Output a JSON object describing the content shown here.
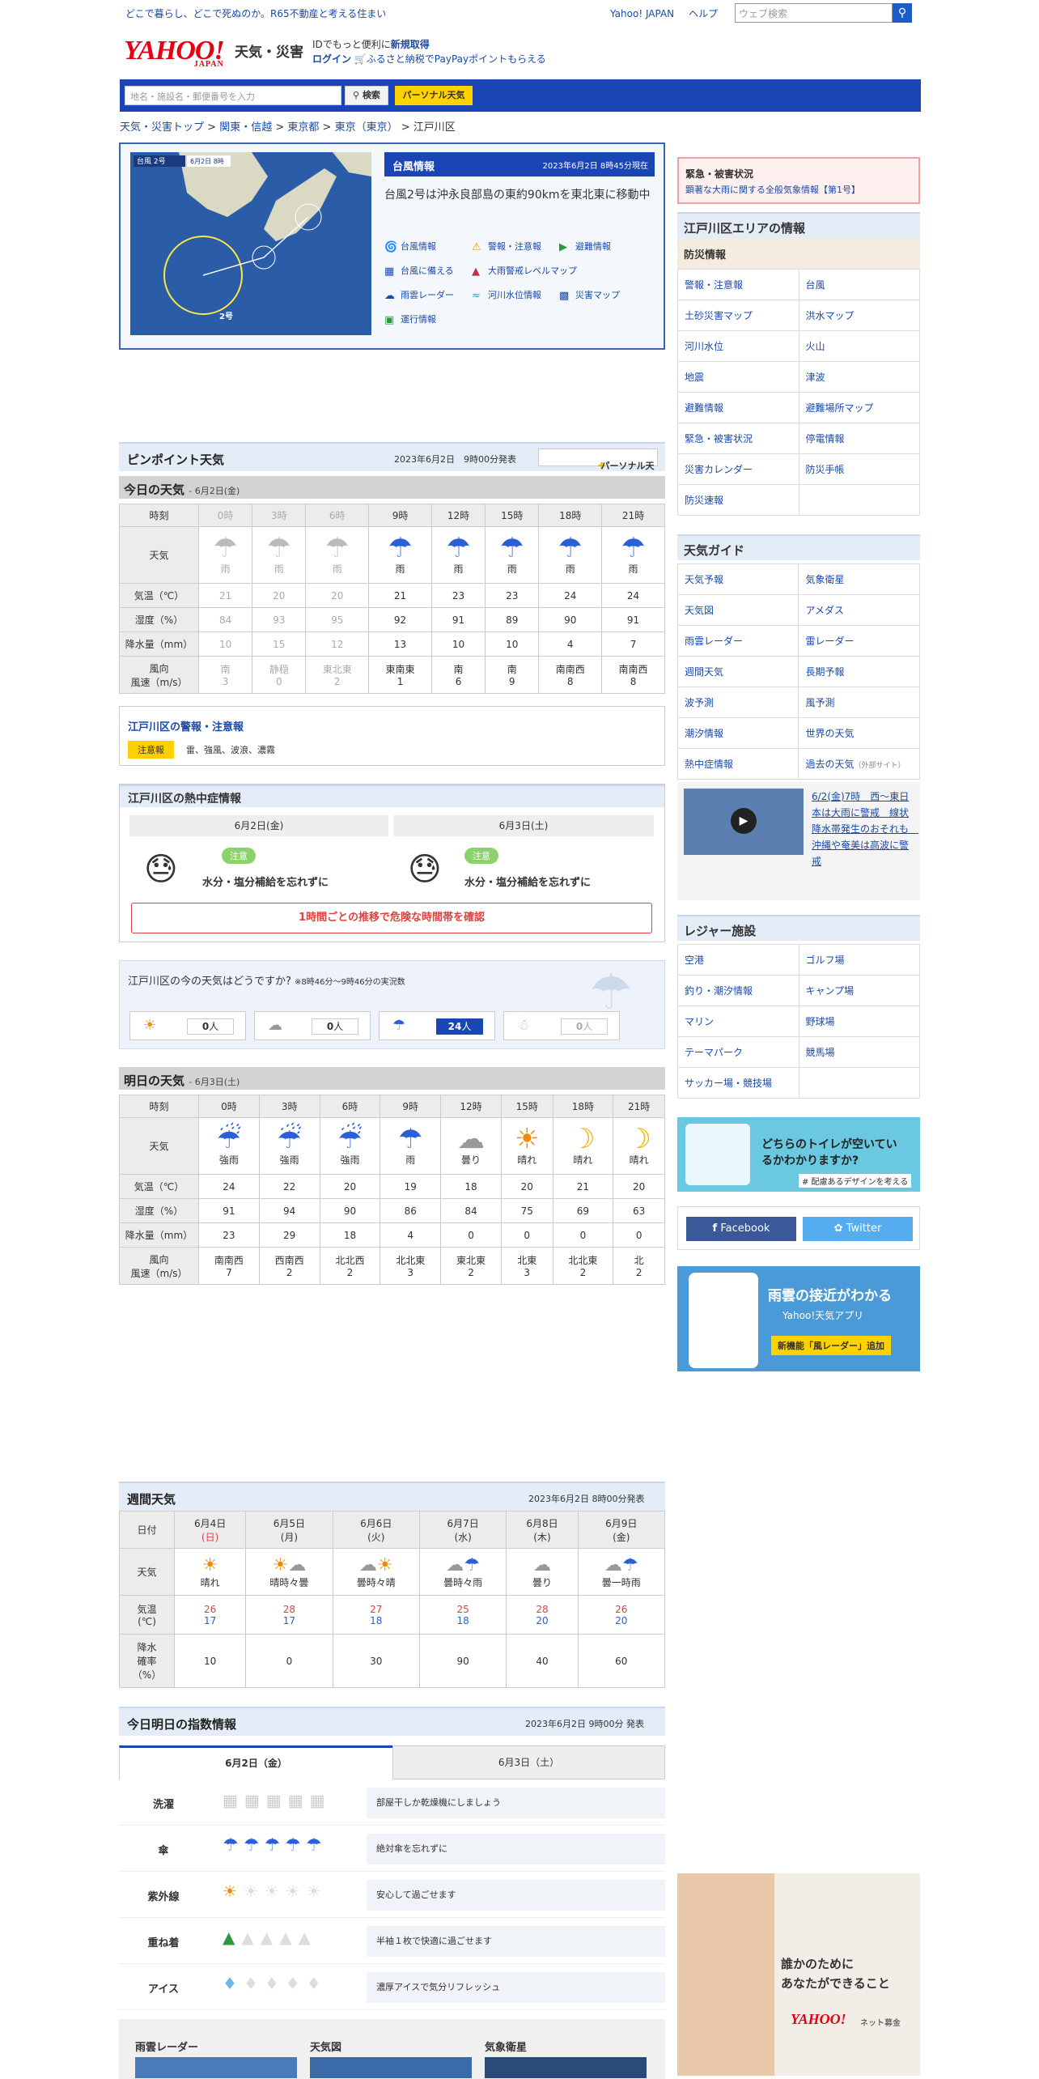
{
  "topbar": {
    "tagline": "どこで暮らし、どこで死ぬのか。R65不動産と考える住まい",
    "link_yahoo": "Yahoo! JAPAN",
    "link_help": "ヘルプ",
    "search_placeholder": "ウェブ検索"
  },
  "header": {
    "logo": "YAHOO!",
    "logo_sub": "JAPAN",
    "service": "天気・災害",
    "id_text": "IDでもっと便利に",
    "id_link": "新規取得",
    "login": "ログイン",
    "promo": "ふるさと納税でPayPayポイントもらえる"
  },
  "nav": {
    "search_placeholder": "地名・施設名・郵便番号を入力",
    "search_btn": "検索",
    "personal_btn": "パーソナル天気"
  },
  "breadcrumb": [
    "天気・災害トップ",
    "関東・信越",
    "東京都",
    "東京（東京）",
    "江戸川区"
  ],
  "typhoon": {
    "map_label": "台風 2号",
    "map_date": "6月2日 8時",
    "map_name": "2号",
    "title": "台風情報",
    "time": "2023年6月2日 8時45分現在",
    "message": "台風2号は沖永良部島の東約90kmを東北東に移動中",
    "links": [
      "台風情報",
      "警報・注意報",
      "避難情報",
      "台風に備える",
      "大雨警戒レベルマップ",
      "雨雲レーダー",
      "河川水位情報",
      "災害マップ",
      "運行情報"
    ]
  },
  "pinpoint": {
    "title": "ピンポイント天気",
    "issued": "2023年6月2日　9時00分発表",
    "add_btn": "パーソナル天気に追加"
  },
  "today": {
    "title": "今日の天気",
    "date": "- 6月2日(金)",
    "labels": {
      "time": "時刻",
      "weather": "天気",
      "temp": "気温（℃）",
      "hum": "湿度（%）",
      "rain": "降水量（mm）",
      "wind": "風向\n風速（m/s）"
    },
    "hours": [
      "0時",
      "3時",
      "6時",
      "9時",
      "12時",
      "15時",
      "18時",
      "21時"
    ],
    "weather": [
      "雨",
      "雨",
      "雨",
      "雨",
      "雨",
      "雨",
      "雨",
      "雨"
    ],
    "temp": [
      "21",
      "20",
      "20",
      "21",
      "23",
      "23",
      "24",
      "24"
    ],
    "hum": [
      "84",
      "93",
      "95",
      "92",
      "91",
      "89",
      "90",
      "91"
    ],
    "rain": [
      "10",
      "15",
      "12",
      "13",
      "10",
      "10",
      "4",
      "7"
    ],
    "wdir": [
      "南",
      "静穏",
      "東北東",
      "東南東",
      "南",
      "南",
      "南南西",
      "南南西"
    ],
    "wspd": [
      "3",
      "0",
      "2",
      "1",
      "6",
      "9",
      "8",
      "8"
    ]
  },
  "warning": {
    "title": "江戸川区の警報・注意報",
    "badge": "注意報",
    "text": "雷、強風、波浪、濃霧"
  },
  "heat": {
    "title": "江戸川区の熱中症情報",
    "days": [
      {
        "date": "6月2日(金)",
        "level": "注意",
        "msg": "水分・塩分補給を忘れずに"
      },
      {
        "date": "6月3日(土)",
        "level": "注意",
        "msg": "水分・塩分補給を忘れずに"
      }
    ],
    "button": "1時間ごとの推移で危険な時間帯を確認"
  },
  "survey": {
    "title": "江戸川区の今の天気はどうですか?",
    "note": "※8時46分～9時46分の実況数",
    "counts": [
      "0",
      "0",
      "24",
      "0"
    ],
    "unit": "人"
  },
  "tomorrow": {
    "title": "明日の天気",
    "date": "- 6月3日(土)",
    "hours": [
      "0時",
      "3時",
      "6時",
      "9時",
      "12時",
      "15時",
      "18時",
      "21時"
    ],
    "weather": [
      "強雨",
      "強雨",
      "強雨",
      "雨",
      "曇り",
      "晴れ",
      "晴れ",
      "晴れ"
    ],
    "temp": [
      "24",
      "22",
      "20",
      "19",
      "18",
      "20",
      "21",
      "20"
    ],
    "hum": [
      "91",
      "94",
      "90",
      "86",
      "84",
      "75",
      "69",
      "63"
    ],
    "rain": [
      "23",
      "29",
      "18",
      "4",
      "0",
      "0",
      "0",
      "0"
    ],
    "wdir": [
      "南南西",
      "西南西",
      "北北西",
      "北北東",
      "東北東",
      "北東",
      "北北東",
      "北"
    ],
    "wspd": [
      "7",
      "2",
      "2",
      "3",
      "2",
      "3",
      "2",
      "2"
    ]
  },
  "weekly": {
    "title": "週間天気",
    "issued": "2023年6月2日 8時00分発表",
    "labels": {
      "date": "日付",
      "weather": "天気",
      "temp": "気温\n(℃)",
      "pop": "降水\n確率\n（%）"
    },
    "days": [
      {
        "date": "6月4日",
        "dow": "(日)",
        "weather": "晴れ",
        "hi": "26",
        "lo": "17",
        "pop": "10"
      },
      {
        "date": "6月5日",
        "dow": "(月)",
        "weather": "晴時々曇",
        "hi": "28",
        "lo": "17",
        "pop": "0"
      },
      {
        "date": "6月6日",
        "dow": "(火)",
        "weather": "曇時々晴",
        "hi": "27",
        "lo": "18",
        "pop": "30"
      },
      {
        "date": "6月7日",
        "dow": "(水)",
        "weather": "曇時々雨",
        "hi": "25",
        "lo": "18",
        "pop": "90"
      },
      {
        "date": "6月8日",
        "dow": "(木)",
        "weather": "曇り",
        "hi": "28",
        "lo": "20",
        "pop": "40"
      },
      {
        "date": "6月9日",
        "dow": "(金)",
        "weather": "曇一時雨",
        "hi": "26",
        "lo": "20",
        "pop": "60"
      }
    ]
  },
  "index": {
    "title": "今日明日の指数情報",
    "issued": "2023年6月2日 9時00分 発表",
    "tab_today": "6月2日（金）",
    "tab_tomorrow": "6月3日（土）",
    "rows": [
      {
        "name": "洗濯",
        "text": "部屋干しか乾燥機にしましょう"
      },
      {
        "name": "傘",
        "text": "絶対傘を忘れずに"
      },
      {
        "name": "紫外線",
        "text": "安心して過ごせます"
      },
      {
        "name": "重ね着",
        "text": "半袖１枚で快適に過ごせます"
      },
      {
        "name": "アイス",
        "text": "濃厚アイスで気分リフレッシュ"
      }
    ]
  },
  "bottom_cards": [
    "雨雲レーダー",
    "天気図",
    "気象衛星"
  ],
  "side": {
    "emergency_title": "緊急・被害状況",
    "emergency_link": "顕著な大雨に関する全般気象情報【第1号】",
    "area_title": "江戸川区エリアの情報",
    "bousai_title": "防災情報",
    "bousai": [
      "警報・注意報",
      "台風",
      "土砂災害マップ",
      "洪水マップ",
      "河川水位",
      "火山",
      "地震",
      "津波",
      "避難情報",
      "避難場所マップ",
      "緊急・被害状況",
      "停電情報",
      "災害カレンダー",
      "防災手帳",
      "防災速報",
      ""
    ],
    "guide_title": "天気ガイド",
    "guide": [
      "天気予報",
      "気象衛星",
      "天気図",
      "アメダス",
      "雨雲レーダー",
      "雷レーダー",
      "週間天気",
      "長期予報",
      "波予測",
      "風予測",
      "潮汐情報",
      "世界の天気",
      "熱中症情報",
      "過去の天気"
    ],
    "guide_ext": "（外部サイト）",
    "video_text": "6/2(金)7時　西～東日本は大雨に警戒　線状降水帯発生のおそれも　沖縄や奄美は高波に警戒",
    "leisure_title": "レジャー施設",
    "leisure": [
      "空港",
      "ゴルフ場",
      "釣り・潮汐情報",
      "キャンプ場",
      "マリン",
      "野球場",
      "テーマパーク",
      "競馬場",
      "サッカー場・競技場",
      ""
    ],
    "ad1": "どちらのトイレが空いているかわかりますか?",
    "ad1_sub": "# 配慮あるデザインを考える",
    "fb": "Facebook",
    "tw": "Twitter",
    "ad2": "雨雲の接近がわかる",
    "ad2_app": "Yahoo!天気アプリ",
    "ad2_new": "新機能「風レーダー」追加",
    "ad3": "誰かのために\nあなたができること",
    "ad3_brand": "ネット募金"
  }
}
